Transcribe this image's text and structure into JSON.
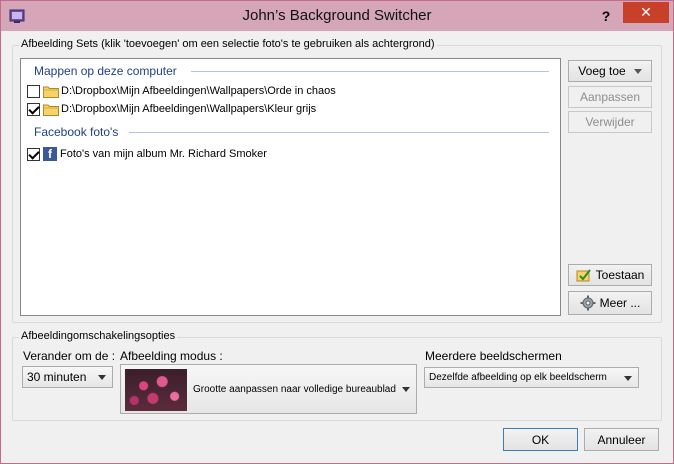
{
  "window": {
    "title": "John’s Background Switcher",
    "help_label": "?",
    "close_label": "✕"
  },
  "sets": {
    "group_label": "Afbeelding Sets (klik 'toevoegen' om een selectie foto's te gebruiken als achtergrond)",
    "sections": [
      {
        "header": "Mappen op deze computer",
        "items": [
          {
            "checked": false,
            "label": "D:\\Dropbox\\Mijn Afbeeldingen\\Wallpapers\\Orde in chaos",
            "icon": "folder-icon"
          },
          {
            "checked": true,
            "label": "D:\\Dropbox\\Mijn Afbeeldingen\\Wallpapers\\Kleur grijs",
            "icon": "folder-icon"
          }
        ]
      },
      {
        "header": "Facebook foto's",
        "items": [
          {
            "checked": true,
            "label": "Foto's van mijn album Mr. Richard Smoker",
            "icon": "facebook-icon"
          }
        ]
      }
    ]
  },
  "side_buttons": {
    "add": "Voeg toe",
    "edit": "Aanpassen",
    "delete": "Verwijder",
    "permit": "Toestaan",
    "more": "Meer ..."
  },
  "options": {
    "group_label": "Afbeeldingomschakelingsopties",
    "interval_label": "Verander om de :",
    "interval_value": "30 minuten",
    "mode_label": "Afbeelding modus :",
    "mode_value": "Grootte aanpassen naar volledige bureaublad",
    "monitors_label": "Meerdere beeldschermen",
    "monitors_value": "Dezelfde afbeelding op elk beeldscherm"
  },
  "footer": {
    "ok": "OK",
    "cancel": "Annuleer"
  },
  "colors": {
    "titlebar": "#d5a6b7",
    "close": "#c7402a",
    "section_header": "#1e3f8a",
    "facebook": "#3b5998"
  }
}
